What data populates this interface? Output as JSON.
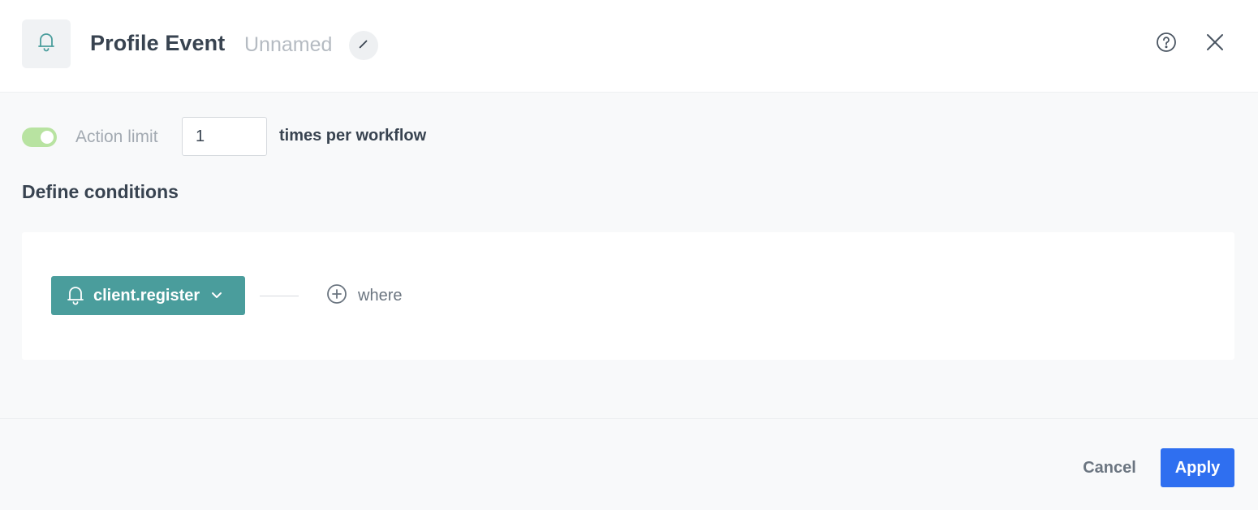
{
  "header": {
    "title": "Profile Event",
    "subtitle": "Unnamed",
    "icon": "bell-icon",
    "help_icon": "question-circle-icon",
    "close_icon": "close-icon",
    "edit_icon": "pencil-icon"
  },
  "action_limit": {
    "enabled": true,
    "label": "Action limit",
    "value": "1",
    "suffix": "times per workflow"
  },
  "conditions": {
    "title": "Define conditions",
    "event": {
      "label": "client.register",
      "icon": "bell-icon"
    },
    "where_label": "where"
  },
  "footer": {
    "cancel_label": "Cancel",
    "apply_label": "Apply"
  },
  "colors": {
    "accent_teal": "#4a9d9c",
    "primary_blue": "#2f6ff0",
    "toggle_on": "#b8e3a1"
  }
}
